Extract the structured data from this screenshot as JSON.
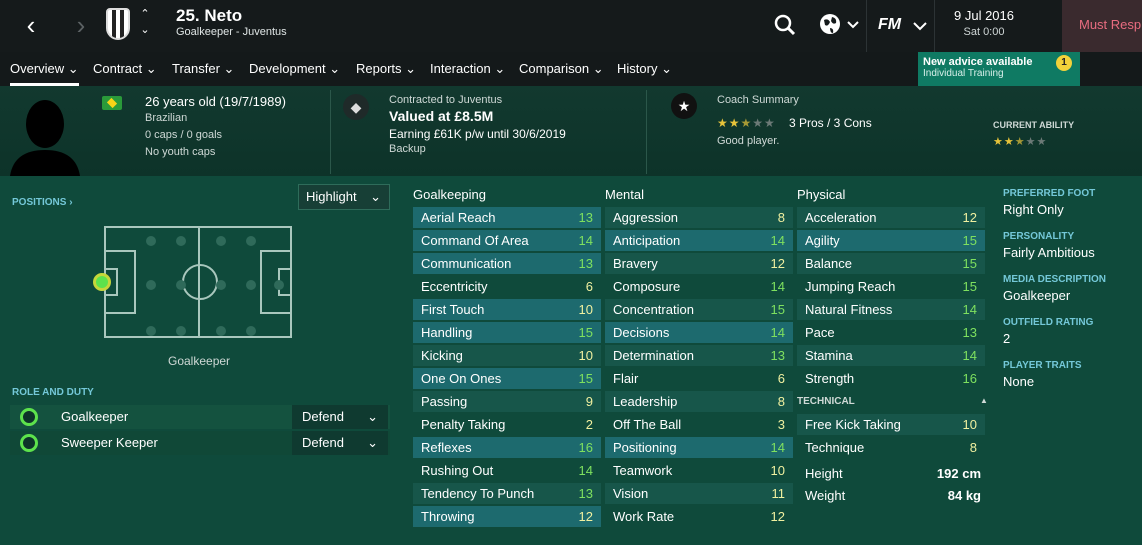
{
  "nav": {
    "back": "‹",
    "forward": "›",
    "up": "⌃",
    "down": "⌄"
  },
  "player": {
    "name": "25. Neto",
    "role": "Goalkeeper - Juventus",
    "age": "26 years old (19/7/1989)",
    "nationality": "Brazilian",
    "caps": "0 caps / 0 goals",
    "youth": "No youth caps"
  },
  "clock": {
    "date": "9 Jul 2016",
    "day": "Sat 0:00"
  },
  "continue_label": "Must Resp",
  "tabs": [
    "Overview",
    "Contract",
    "Transfer",
    "Development",
    "Reports",
    "Interaction",
    "Comparison",
    "History"
  ],
  "advice": {
    "title": "New advice available",
    "subtitle": "Individual Training",
    "count": "1"
  },
  "contract": {
    "label": "Contracted to Juventus",
    "value": "Valued at £8.5M",
    "earning": "Earning £61K p/w until 30/6/2019",
    "status": "Backup"
  },
  "coach": {
    "label": "Coach Summary",
    "pros_cons": "3 Pros / 3 Cons",
    "text": "Good player.",
    "stars": 2.5
  },
  "ability": {
    "label": "CURRENT ABILITY",
    "stars": 2.5
  },
  "positions": {
    "label": "POSITIONS ›",
    "highlight": "Highlight",
    "position": "Goalkeeper"
  },
  "role_duty": {
    "label": "ROLE AND DUTY",
    "rows": [
      {
        "role": "Goalkeeper",
        "duty": "Defend"
      },
      {
        "role": "Sweeper Keeper",
        "duty": "Defend"
      }
    ]
  },
  "columns": {
    "gk": "Goalkeeping",
    "mental": "Mental",
    "physical": "Physical",
    "technical": "TECHNICAL"
  },
  "goalkeeping": [
    [
      "Aerial Reach",
      "13"
    ],
    [
      "Command Of Area",
      "14"
    ],
    [
      "Communication",
      "13"
    ],
    [
      "Eccentricity",
      "6"
    ],
    [
      "First Touch",
      "10"
    ],
    [
      "Handling",
      "15"
    ],
    [
      "Kicking",
      "10"
    ],
    [
      "One On Ones",
      "15"
    ],
    [
      "Passing",
      "9"
    ],
    [
      "Penalty Taking",
      "2"
    ],
    [
      "Reflexes",
      "16"
    ],
    [
      "Rushing Out",
      "14"
    ],
    [
      "Tendency To Punch",
      "13"
    ],
    [
      "Throwing",
      "12"
    ]
  ],
  "mental": [
    [
      "Aggression",
      "8"
    ],
    [
      "Anticipation",
      "14"
    ],
    [
      "Bravery",
      "12"
    ],
    [
      "Composure",
      "14"
    ],
    [
      "Concentration",
      "15"
    ],
    [
      "Decisions",
      "14"
    ],
    [
      "Determination",
      "13"
    ],
    [
      "Flair",
      "6"
    ],
    [
      "Leadership",
      "8"
    ],
    [
      "Off The Ball",
      "3"
    ],
    [
      "Positioning",
      "14"
    ],
    [
      "Teamwork",
      "10"
    ],
    [
      "Vision",
      "11"
    ],
    [
      "Work Rate",
      "12"
    ]
  ],
  "physical": [
    [
      "Acceleration",
      "12"
    ],
    [
      "Agility",
      "15"
    ],
    [
      "Balance",
      "15"
    ],
    [
      "Jumping Reach",
      "15"
    ],
    [
      "Natural Fitness",
      "14"
    ],
    [
      "Pace",
      "13"
    ],
    [
      "Stamina",
      "14"
    ],
    [
      "Strength",
      "16"
    ]
  ],
  "technical": [
    [
      "Free Kick Taking",
      "10"
    ],
    [
      "Technique",
      "8"
    ]
  ],
  "body": [
    [
      "Height",
      "192 cm"
    ],
    [
      "Weight",
      "84 kg"
    ]
  ],
  "side": [
    {
      "label": "PREFERRED FOOT",
      "value": "Right Only"
    },
    {
      "label": "PERSONALITY",
      "value": "Fairly Ambitious"
    },
    {
      "label": "MEDIA DESCRIPTION",
      "value": "Goalkeeper"
    },
    {
      "label": "OUTFIELD RATING",
      "value": "2"
    },
    {
      "label": "PLAYER TRAITS",
      "value": "None"
    }
  ]
}
